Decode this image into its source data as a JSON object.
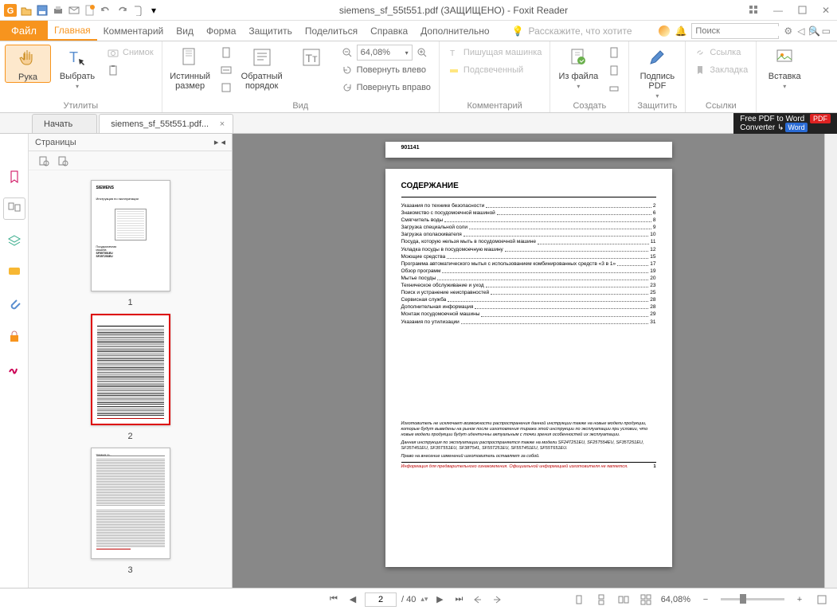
{
  "window": {
    "title": "siemens_sf_55t551.pdf (ЗАЩИЩЕНО) - Foxit Reader"
  },
  "menu": {
    "file": "Файл",
    "tabs": [
      "Главная",
      "Комментарий",
      "Вид",
      "Форма",
      "Защитить",
      "Поделиться",
      "Справка",
      "Дополнительно"
    ],
    "tell_placeholder": "Расскажите, что хотите",
    "search_placeholder": "Поиск"
  },
  "ribbon": {
    "groups": {
      "utilities": {
        "label": "Утилиты",
        "hand": "Рука",
        "select": "Выбрать",
        "snapshot": "Снимок"
      },
      "view": {
        "label": "Вид",
        "actual": "Истинный размер",
        "reflow": "Обратный порядок",
        "zoom_value": "64,08%",
        "rotate_left": "Повернуть влево",
        "rotate_right": "Повернуть вправо"
      },
      "comment": {
        "label": "Комментарий",
        "typewriter": "Пишущая машинка",
        "highlight": "Подсвеченный"
      },
      "create": {
        "label": "Создать",
        "from_file": "Из файла"
      },
      "protect": {
        "label": "Защитить",
        "sign": "Подпись PDF"
      },
      "links": {
        "label": "Ссылки",
        "link": "Ссылка",
        "bookmark": "Закладка"
      },
      "insert": {
        "label": "",
        "insert": "Вставка"
      }
    }
  },
  "doctabs": {
    "start": "Начать",
    "doc": "siemens_sf_55t551.pdf..."
  },
  "ad": {
    "line1": "Free PDF to Word",
    "line2": "Converter",
    "pdf": "PDF",
    "word": "Word"
  },
  "sidepanel": {
    "pages_label": "Страницы",
    "thumbs": [
      "1",
      "2",
      "3"
    ]
  },
  "document": {
    "header_num": "901141",
    "toc_title": "СОДЕРЖАНИЕ",
    "toc": [
      {
        "t": "Указания по технике безопасности",
        "p": "2"
      },
      {
        "t": "Знакомство с посудомоечной машиной",
        "p": "6"
      },
      {
        "t": "Смягчитель воды",
        "p": "8"
      },
      {
        "t": "Загрузка специальной соли",
        "p": "9"
      },
      {
        "t": "Загрузка ополаскивателя",
        "p": "10"
      },
      {
        "t": "Посуда, которую нельзя мыть в посудомоечной машине",
        "p": "11"
      },
      {
        "t": "Укладка посуды в посудомоечную машину",
        "p": "12"
      },
      {
        "t": "Моющие средства",
        "p": "15"
      },
      {
        "t": "Программа автоматического мытья с использованием комбинированных средств «3 в 1»",
        "p": "17"
      },
      {
        "t": "Обзор программ",
        "p": "19"
      },
      {
        "t": "Мытье посуды",
        "p": "20"
      },
      {
        "t": "Техническое обслуживание и уход",
        "p": "23"
      },
      {
        "t": "Поиск и устранение неисправностей",
        "p": "25"
      },
      {
        "t": "Сервисная служба",
        "p": "28"
      },
      {
        "t": "Дополнительная информация",
        "p": "28"
      },
      {
        "t": "Монтаж посудомоечной машины",
        "p": "29"
      },
      {
        "t": "Указания по утилизации",
        "p": "31"
      }
    ],
    "footer_p1": "Изготовитель не исключает возможности распространения данной инструкции также на новые модели продукции, которые будут выведены на рынок после изготовления тиража этой инструкции по эксплуатации при условии, что новые модели продукции будут идентичны актуальным с точки зрения особенностей их эксплуатации.",
    "footer_p2": "Данная инструкция по эксплуатации распространяется также на модели SF24T251EU, SF25T554EU, SF35T251EU, SF35T451EU, SF35T551EU, SF38T541, SF55T251EU, SF55T451EU, SF55T651EU.",
    "footer_p3": "Право на внесение изменений изготовитель оставляет за собой.",
    "footer_red": "Информация для предварительного ознакомления. Официальной информацией изготовителя не является.",
    "footer_page": "1"
  },
  "status": {
    "page_current": "2",
    "page_total": "/ 40",
    "zoom": "64,08%"
  }
}
